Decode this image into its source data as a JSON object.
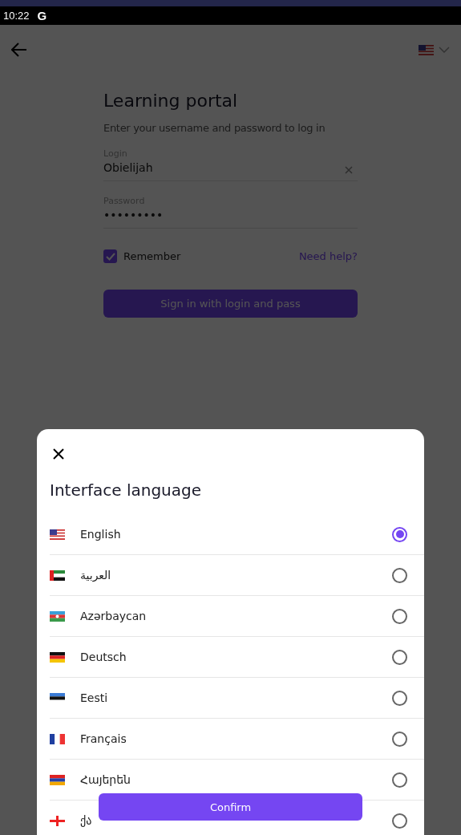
{
  "status_bar": {
    "time": "10:22",
    "app_icon_text": "G"
  },
  "login": {
    "title": "Learning portal",
    "subtitle": "Enter your username and password to log in",
    "login_field": {
      "label": "Login",
      "value": "Obielijah"
    },
    "password_field": {
      "label": "Password",
      "value": "•••••••••"
    },
    "remember": {
      "label": "Remember",
      "checked": true
    },
    "help_link": "Need help?",
    "submit": "Sign in with login and pass"
  },
  "language_sheet": {
    "title": "Interface language",
    "languages": [
      {
        "label": "English",
        "selected": true
      },
      {
        "label": "العربية",
        "selected": false
      },
      {
        "label": "Azərbaycan",
        "selected": false
      },
      {
        "label": "Deutsch",
        "selected": false
      },
      {
        "label": "Eesti",
        "selected": false
      },
      {
        "label": "Français",
        "selected": false
      },
      {
        "label": "Հայերեն",
        "selected": false
      },
      {
        "label": "ქა",
        "selected": false
      }
    ],
    "confirm": "Confirm"
  }
}
